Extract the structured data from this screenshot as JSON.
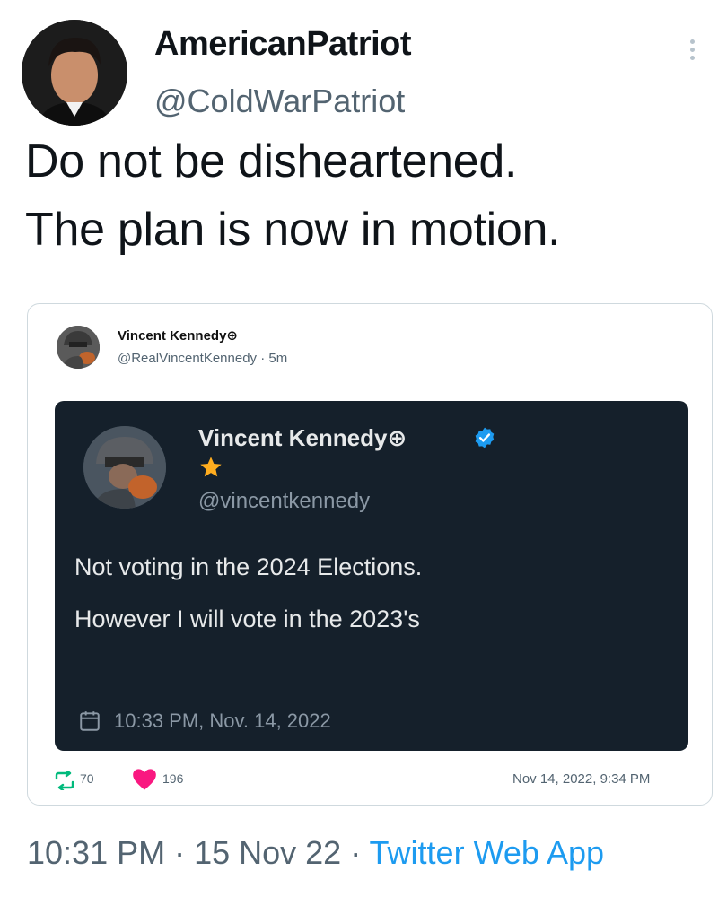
{
  "author": {
    "display_name": "AmericanPatriot",
    "handle": "@ColdWarPatriot"
  },
  "tweet": {
    "line1": "Do not be disheartened.",
    "line2": "The plan is now in motion."
  },
  "quoted": {
    "display_name": "Vincent Kennedy⊕",
    "meta": "@RealVincentKennedy · 5m",
    "embedded": {
      "display_name": "Vincent Kennedy⊕",
      "handle": "@vincentkennedy",
      "line1": "Not voting in the 2024 Elections.",
      "line2": "However I will vote in the 2023's",
      "timestamp": "10:33 PM, Nov. 14, 2022"
    },
    "retweets": "70",
    "likes": "196",
    "date": "Nov 14, 2022, 9:34 PM"
  },
  "footer": {
    "time": "10:31 PM",
    "separator1": " · ",
    "date": "15 Nov 22",
    "separator2": " · ",
    "app": "Twitter Web App"
  },
  "colors": {
    "accent": "#1d9bf0",
    "dark_card": "#15202b",
    "like": "#f91880",
    "retweet": "#00ba7c",
    "star": "#ffad1f"
  },
  "icons": [
    "more-icon",
    "verified-icon",
    "star-icon",
    "calendar-icon",
    "retweet-icon",
    "heart-icon"
  ]
}
